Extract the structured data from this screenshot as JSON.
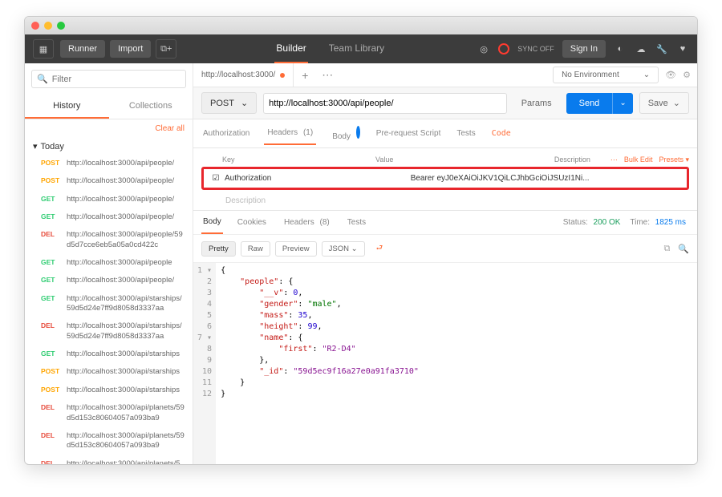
{
  "topbar": {
    "runner": "Runner",
    "import": "Import",
    "builder": "Builder",
    "teamlib": "Team Library",
    "sync": "SYNC OFF",
    "signin": "Sign In"
  },
  "sidebar": {
    "filter_placeholder": "Filter",
    "history_tab": "History",
    "collections_tab": "Collections",
    "clear_all": "Clear all",
    "group": "Today",
    "items": [
      {
        "method": "POST",
        "cls": "m-post",
        "url": "http://localhost:3000/api/people/"
      },
      {
        "method": "POST",
        "cls": "m-post",
        "url": "http://localhost:3000/api/people/"
      },
      {
        "method": "GET",
        "cls": "m-get",
        "url": "http://localhost:3000/api/people/"
      },
      {
        "method": "GET",
        "cls": "m-get",
        "url": "http://localhost:3000/api/people/"
      },
      {
        "method": "DEL",
        "cls": "m-del",
        "url": "http://localhost:3000/api/people/59d5d7cce6eb5a05a0cd422c"
      },
      {
        "method": "GET",
        "cls": "m-get",
        "url": "http://localhost:3000/api/people"
      },
      {
        "method": "GET",
        "cls": "m-get",
        "url": "http://localhost:3000/api/people/"
      },
      {
        "method": "GET",
        "cls": "m-get",
        "url": "http://localhost:3000/api/starships/59d5d24e7ff9d8058d3337aa"
      },
      {
        "method": "DEL",
        "cls": "m-del",
        "url": "http://localhost:3000/api/starships/59d5d24e7ff9d8058d3337aa"
      },
      {
        "method": "GET",
        "cls": "m-get",
        "url": "http://localhost:3000/api/starships"
      },
      {
        "method": "POST",
        "cls": "m-post",
        "url": "http://localhost:3000/api/starships"
      },
      {
        "method": "POST",
        "cls": "m-post",
        "url": "http://localhost:3000/api/starships"
      },
      {
        "method": "DEL",
        "cls": "m-del",
        "url": "http://localhost:3000/api/planets/59d5d153c80604057a093ba9"
      },
      {
        "method": "DEL",
        "cls": "m-del",
        "url": "http://localhost:3000/api/planets/59d5d153c80604057a093ba9"
      },
      {
        "method": "DEL",
        "cls": "m-del",
        "url": "http://localhost:3000/api/planets/5"
      }
    ]
  },
  "main": {
    "tab_title": "http://localhost:3000/",
    "env": "No Environment",
    "method": "POST",
    "url": "http://localhost:3000/api/people/",
    "params": "Params",
    "send": "Send",
    "save": "Save",
    "subtabs": {
      "auth": "Authorization",
      "headers": "Headers",
      "headers_n": "(1)",
      "body": "Body",
      "pre": "Pre-request Script",
      "tests": "Tests",
      "code": "Code"
    },
    "headers_table": {
      "cols": {
        "key": "Key",
        "value": "Value",
        "desc": "Description"
      },
      "bulk": "Bulk Edit",
      "presets": "Presets",
      "row": {
        "key": "Authorization",
        "value": "Bearer eyJ0eXAiOiJKV1QiLCJhbGciOiJSUzI1Ni..."
      }
    }
  },
  "response": {
    "tabs": {
      "body": "Body",
      "cookies": "Cookies",
      "headers": "Headers",
      "headers_n": "(8)",
      "tests": "Tests"
    },
    "status_label": "Status:",
    "status": "200 OK",
    "time_label": "Time:",
    "time": "1825 ms",
    "views": {
      "pretty": "Pretty",
      "raw": "Raw",
      "preview": "Preview",
      "json": "JSON"
    },
    "json": {
      "people": {
        "__v": 0,
        "gender": "male",
        "mass": 35,
        "height": 99,
        "name": {
          "first": "R2-D4"
        },
        "_id": "59d5ec9f16a27e0a91fa3710"
      }
    }
  }
}
